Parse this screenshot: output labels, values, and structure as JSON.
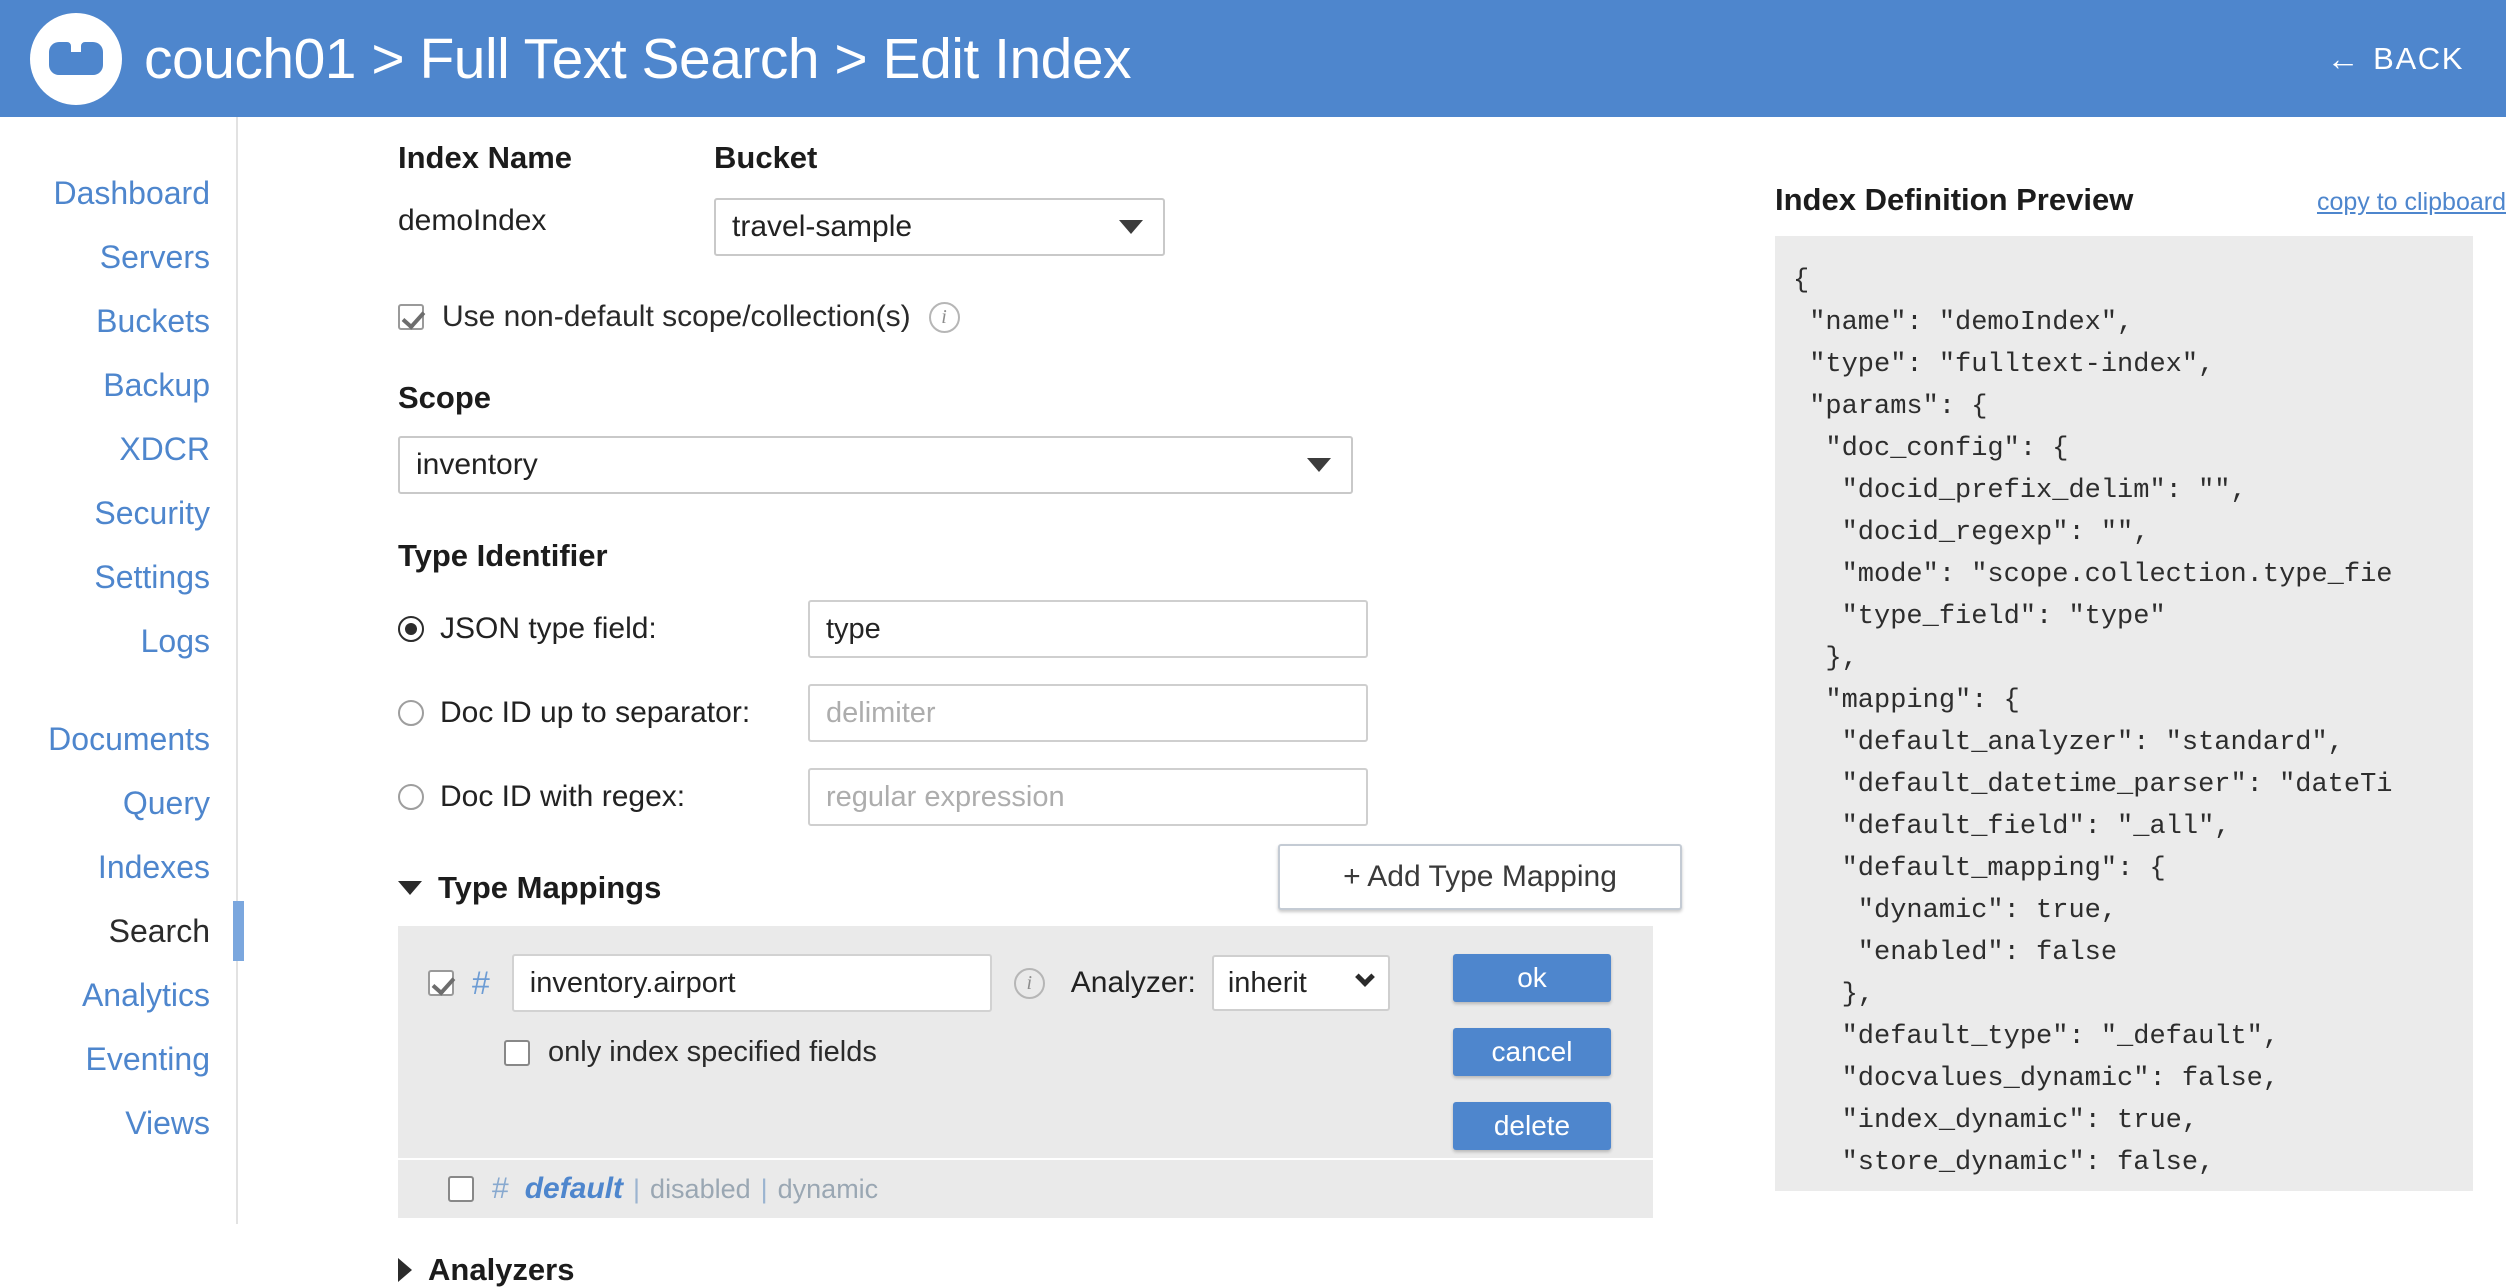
{
  "header": {
    "logo_icon": "couchbase-logo-icon",
    "breadcrumb": "couch01 > Full Text Search > Edit Index",
    "back_label": "BACK",
    "back_icon": "arrow-left-icon",
    "bg_color": "#4e86cd"
  },
  "sidebar": {
    "items": [
      {
        "label": "Dashboard",
        "active": false
      },
      {
        "label": "Servers",
        "active": false
      },
      {
        "label": "Buckets",
        "active": false
      },
      {
        "label": "Backup",
        "active": false
      },
      {
        "label": "XDCR",
        "active": false
      },
      {
        "label": "Security",
        "active": false
      },
      {
        "label": "Settings",
        "active": false
      },
      {
        "label": "Logs",
        "active": false
      },
      {
        "label": "Documents",
        "active": false
      },
      {
        "label": "Query",
        "active": false
      },
      {
        "label": "Indexes",
        "active": false
      },
      {
        "label": "Search",
        "active": true
      },
      {
        "label": "Analytics",
        "active": false
      },
      {
        "label": "Eventing",
        "active": false
      },
      {
        "label": "Views",
        "active": false
      }
    ],
    "link_color": "#4e86cd",
    "active_color": "#2b2b2b"
  },
  "form": {
    "index_name_label": "Index Name",
    "index_name_value": "demoIndex",
    "bucket_label": "Bucket",
    "bucket_value": "travel-sample",
    "non_default_scope_label": "Use non-default scope/collection(s)",
    "non_default_scope_checked": true,
    "non_default_scope_info_icon": "info-icon",
    "scope_label": "Scope",
    "scope_value": "inventory",
    "type_identifier_label": "Type Identifier",
    "type_options": [
      {
        "label": "JSON type field:",
        "selected": true,
        "value": "type",
        "placeholder": ""
      },
      {
        "label": "Doc ID up to separator:",
        "selected": false,
        "value": "",
        "placeholder": "delimiter"
      },
      {
        "label": "Doc ID with regex:",
        "selected": false,
        "value": "",
        "placeholder": "regular expression"
      }
    ]
  },
  "type_mappings": {
    "section_label": "Type Mappings",
    "expanded": true,
    "expand_icon": "triangle-down-icon",
    "add_button_label": "+ Add Type Mapping",
    "edit_row": {
      "enabled_checkbox": true,
      "hash_icon": "hash-icon",
      "name_value": "inventory.airport",
      "info_icon": "info-icon",
      "analyzer_label": "Analyzer:",
      "analyzer_value": "inherit",
      "only_index_label": "only index specified fields",
      "only_index_checked": false,
      "ok_label": "ok",
      "cancel_label": "cancel",
      "delete_label": "delete",
      "button_color": "#4e86cd"
    },
    "default_row": {
      "enabled_checkbox": false,
      "hash_icon": "hash-icon",
      "name": "default",
      "status": "disabled",
      "mode": "dynamic",
      "separator": "|"
    }
  },
  "analyzers": {
    "section_label": "Analyzers",
    "expanded": false,
    "expand_icon": "triangle-right-icon"
  },
  "preview": {
    "title": "Index Definition Preview",
    "copy_label": "copy to clipboard",
    "json_text": "{\n \"name\": \"demoIndex\",\n \"type\": \"fulltext-index\",\n \"params\": {\n  \"doc_config\": {\n   \"docid_prefix_delim\": \"\",\n   \"docid_regexp\": \"\",\n   \"mode\": \"scope.collection.type_fie\n   \"type_field\": \"type\"\n  },\n  \"mapping\": {\n   \"default_analyzer\": \"standard\",\n   \"default_datetime_parser\": \"dateTi\n   \"default_field\": \"_all\",\n   \"default_mapping\": {\n    \"dynamic\": true,\n    \"enabled\": false\n   },\n   \"default_type\": \"_default\",\n   \"docvalues_dynamic\": false,\n   \"index_dynamic\": true,\n   \"store_dynamic\": false,\n   \"type_field\": \"type\""
  }
}
